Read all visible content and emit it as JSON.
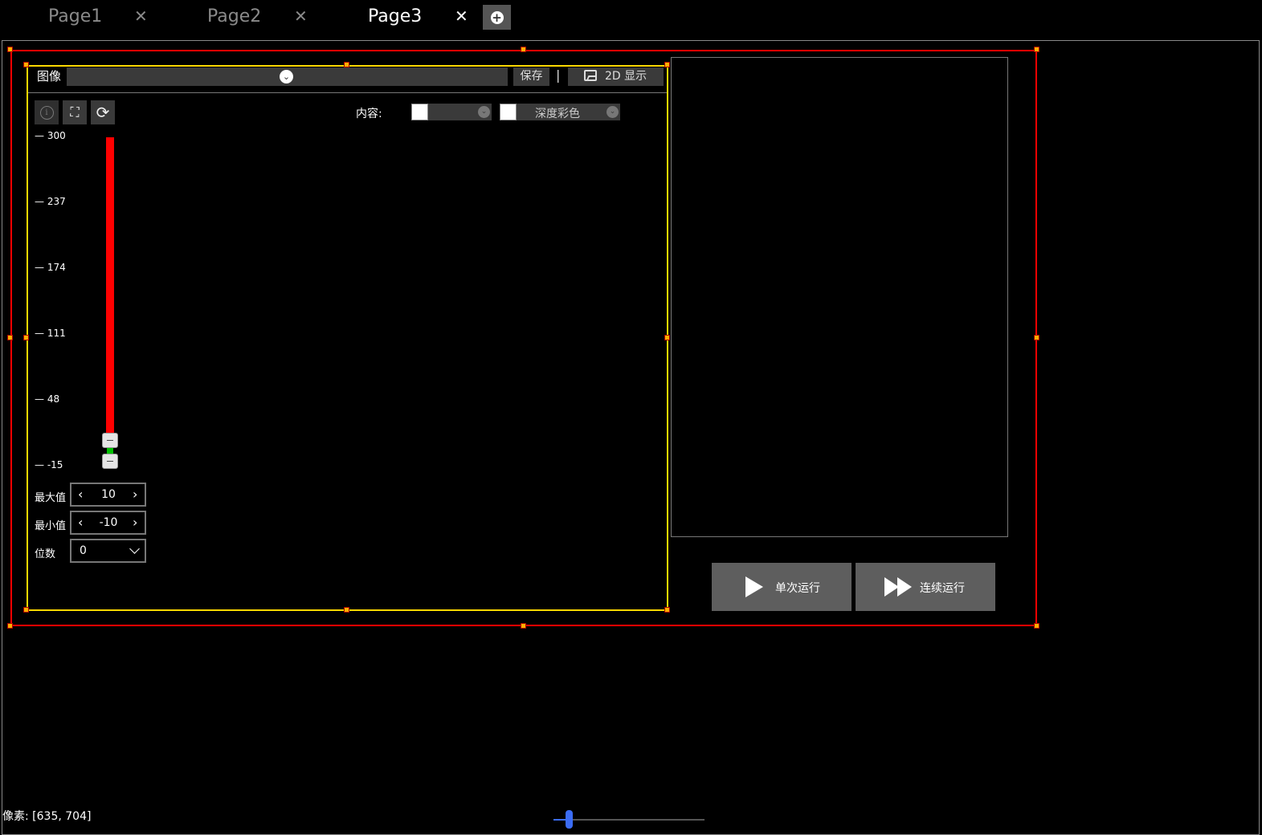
{
  "tabs": [
    {
      "label": "Page1",
      "close": "✕",
      "active": false
    },
    {
      "label": "Page2",
      "close": "✕",
      "active": false
    },
    {
      "label": "Page3",
      "close": "✕",
      "active": true
    }
  ],
  "image_panel": {
    "title": "图像",
    "source_value": "",
    "save_label": "保存",
    "separator": "|",
    "display_label": "2D 显示",
    "content_label": "内容:",
    "content_combo1_value": "",
    "content_combo2_value": "深度彩色"
  },
  "tools": {
    "info": "i",
    "expand": "⛶",
    "refresh": "⟳"
  },
  "scale": {
    "ticks": [
      "300",
      "237",
      "174",
      "111",
      "48",
      "-15"
    ],
    "upper_value": 10,
    "lower_value": -10,
    "range": [
      -15,
      300
    ]
  },
  "fields": {
    "max_label": "最大值",
    "max_value": "10",
    "min_label": "最小值",
    "min_value": "-10",
    "digits_label": "位数",
    "digits_value": "0"
  },
  "run": {
    "single_label": "单次运行",
    "continuous_label": "连续运行"
  },
  "status": {
    "pixel_text": "像素: [635, 704]",
    "zoom_level": 0.1
  },
  "colors": {
    "selection_outer": "#ff0000",
    "selection_inner": "#ffd800",
    "zoom_accent": "#3b6cf5"
  }
}
